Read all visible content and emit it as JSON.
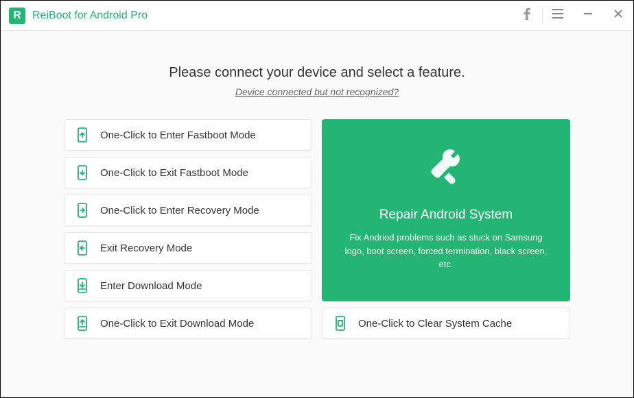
{
  "titlebar": {
    "app_title": "ReiBoot for Android Pro",
    "logo_letter": "R"
  },
  "heading": {
    "main": "Please connect your device and select a feature.",
    "sub_link": "Device connected but not recognized?"
  },
  "options": {
    "enter_fastboot": "One-Click to Enter Fastboot Mode",
    "exit_fastboot": "One-Click to Exit Fastboot Mode",
    "enter_recovery": "One-Click to Enter Recovery Mode",
    "exit_recovery": "Exit Recovery Mode",
    "enter_download": "Enter Download Mode",
    "exit_download": "One-Click to Exit Download Mode",
    "clear_cache": "One-Click to Clear System Cache"
  },
  "big_card": {
    "title": "Repair Android System",
    "desc": "Fix Andriod problems such as stuck on Samsung logo, boot screen, forced termination, black screen, etc."
  },
  "colors": {
    "accent": "#22b573"
  }
}
